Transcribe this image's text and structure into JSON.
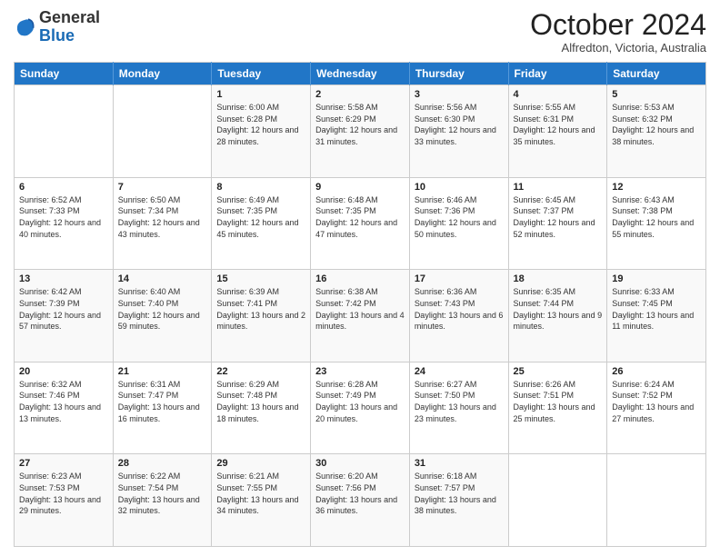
{
  "header": {
    "logo_general": "General",
    "logo_blue": "Blue",
    "month": "October 2024",
    "location": "Alfredton, Victoria, Australia"
  },
  "weekdays": [
    "Sunday",
    "Monday",
    "Tuesday",
    "Wednesday",
    "Thursday",
    "Friday",
    "Saturday"
  ],
  "weeks": [
    [
      {
        "day": "",
        "sunrise": "",
        "sunset": "",
        "daylight": ""
      },
      {
        "day": "",
        "sunrise": "",
        "sunset": "",
        "daylight": ""
      },
      {
        "day": "1",
        "sunrise": "Sunrise: 6:00 AM",
        "sunset": "Sunset: 6:28 PM",
        "daylight": "Daylight: 12 hours and 28 minutes."
      },
      {
        "day": "2",
        "sunrise": "Sunrise: 5:58 AM",
        "sunset": "Sunset: 6:29 PM",
        "daylight": "Daylight: 12 hours and 31 minutes."
      },
      {
        "day": "3",
        "sunrise": "Sunrise: 5:56 AM",
        "sunset": "Sunset: 6:30 PM",
        "daylight": "Daylight: 12 hours and 33 minutes."
      },
      {
        "day": "4",
        "sunrise": "Sunrise: 5:55 AM",
        "sunset": "Sunset: 6:31 PM",
        "daylight": "Daylight: 12 hours and 35 minutes."
      },
      {
        "day": "5",
        "sunrise": "Sunrise: 5:53 AM",
        "sunset": "Sunset: 6:32 PM",
        "daylight": "Daylight: 12 hours and 38 minutes."
      }
    ],
    [
      {
        "day": "6",
        "sunrise": "Sunrise: 6:52 AM",
        "sunset": "Sunset: 7:33 PM",
        "daylight": "Daylight: 12 hours and 40 minutes."
      },
      {
        "day": "7",
        "sunrise": "Sunrise: 6:50 AM",
        "sunset": "Sunset: 7:34 PM",
        "daylight": "Daylight: 12 hours and 43 minutes."
      },
      {
        "day": "8",
        "sunrise": "Sunrise: 6:49 AM",
        "sunset": "Sunset: 7:35 PM",
        "daylight": "Daylight: 12 hours and 45 minutes."
      },
      {
        "day": "9",
        "sunrise": "Sunrise: 6:48 AM",
        "sunset": "Sunset: 7:35 PM",
        "daylight": "Daylight: 12 hours and 47 minutes."
      },
      {
        "day": "10",
        "sunrise": "Sunrise: 6:46 AM",
        "sunset": "Sunset: 7:36 PM",
        "daylight": "Daylight: 12 hours and 50 minutes."
      },
      {
        "day": "11",
        "sunrise": "Sunrise: 6:45 AM",
        "sunset": "Sunset: 7:37 PM",
        "daylight": "Daylight: 12 hours and 52 minutes."
      },
      {
        "day": "12",
        "sunrise": "Sunrise: 6:43 AM",
        "sunset": "Sunset: 7:38 PM",
        "daylight": "Daylight: 12 hours and 55 minutes."
      }
    ],
    [
      {
        "day": "13",
        "sunrise": "Sunrise: 6:42 AM",
        "sunset": "Sunset: 7:39 PM",
        "daylight": "Daylight: 12 hours and 57 minutes."
      },
      {
        "day": "14",
        "sunrise": "Sunrise: 6:40 AM",
        "sunset": "Sunset: 7:40 PM",
        "daylight": "Daylight: 12 hours and 59 minutes."
      },
      {
        "day": "15",
        "sunrise": "Sunrise: 6:39 AM",
        "sunset": "Sunset: 7:41 PM",
        "daylight": "Daylight: 13 hours and 2 minutes."
      },
      {
        "day": "16",
        "sunrise": "Sunrise: 6:38 AM",
        "sunset": "Sunset: 7:42 PM",
        "daylight": "Daylight: 13 hours and 4 minutes."
      },
      {
        "day": "17",
        "sunrise": "Sunrise: 6:36 AM",
        "sunset": "Sunset: 7:43 PM",
        "daylight": "Daylight: 13 hours and 6 minutes."
      },
      {
        "day": "18",
        "sunrise": "Sunrise: 6:35 AM",
        "sunset": "Sunset: 7:44 PM",
        "daylight": "Daylight: 13 hours and 9 minutes."
      },
      {
        "day": "19",
        "sunrise": "Sunrise: 6:33 AM",
        "sunset": "Sunset: 7:45 PM",
        "daylight": "Daylight: 13 hours and 11 minutes."
      }
    ],
    [
      {
        "day": "20",
        "sunrise": "Sunrise: 6:32 AM",
        "sunset": "Sunset: 7:46 PM",
        "daylight": "Daylight: 13 hours and 13 minutes."
      },
      {
        "day": "21",
        "sunrise": "Sunrise: 6:31 AM",
        "sunset": "Sunset: 7:47 PM",
        "daylight": "Daylight: 13 hours and 16 minutes."
      },
      {
        "day": "22",
        "sunrise": "Sunrise: 6:29 AM",
        "sunset": "Sunset: 7:48 PM",
        "daylight": "Daylight: 13 hours and 18 minutes."
      },
      {
        "day": "23",
        "sunrise": "Sunrise: 6:28 AM",
        "sunset": "Sunset: 7:49 PM",
        "daylight": "Daylight: 13 hours and 20 minutes."
      },
      {
        "day": "24",
        "sunrise": "Sunrise: 6:27 AM",
        "sunset": "Sunset: 7:50 PM",
        "daylight": "Daylight: 13 hours and 23 minutes."
      },
      {
        "day": "25",
        "sunrise": "Sunrise: 6:26 AM",
        "sunset": "Sunset: 7:51 PM",
        "daylight": "Daylight: 13 hours and 25 minutes."
      },
      {
        "day": "26",
        "sunrise": "Sunrise: 6:24 AM",
        "sunset": "Sunset: 7:52 PM",
        "daylight": "Daylight: 13 hours and 27 minutes."
      }
    ],
    [
      {
        "day": "27",
        "sunrise": "Sunrise: 6:23 AM",
        "sunset": "Sunset: 7:53 PM",
        "daylight": "Daylight: 13 hours and 29 minutes."
      },
      {
        "day": "28",
        "sunrise": "Sunrise: 6:22 AM",
        "sunset": "Sunset: 7:54 PM",
        "daylight": "Daylight: 13 hours and 32 minutes."
      },
      {
        "day": "29",
        "sunrise": "Sunrise: 6:21 AM",
        "sunset": "Sunset: 7:55 PM",
        "daylight": "Daylight: 13 hours and 34 minutes."
      },
      {
        "day": "30",
        "sunrise": "Sunrise: 6:20 AM",
        "sunset": "Sunset: 7:56 PM",
        "daylight": "Daylight: 13 hours and 36 minutes."
      },
      {
        "day": "31",
        "sunrise": "Sunrise: 6:18 AM",
        "sunset": "Sunset: 7:57 PM",
        "daylight": "Daylight: 13 hours and 38 minutes."
      },
      {
        "day": "",
        "sunrise": "",
        "sunset": "",
        "daylight": ""
      },
      {
        "day": "",
        "sunrise": "",
        "sunset": "",
        "daylight": ""
      }
    ]
  ]
}
